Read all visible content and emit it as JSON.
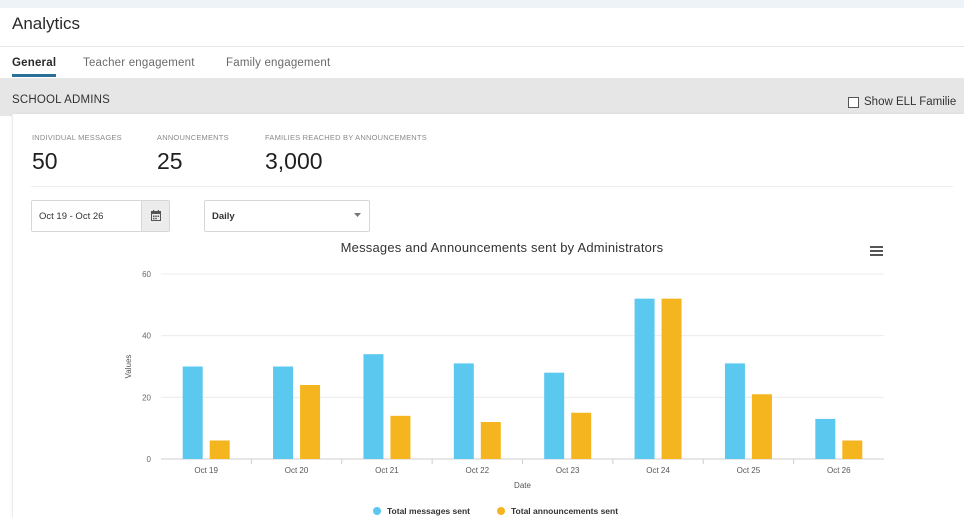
{
  "page": {
    "title": "Analytics"
  },
  "tabs": [
    {
      "label": "General",
      "active": true
    },
    {
      "label": "Teacher engagement",
      "active": false
    },
    {
      "label": "Family engagement",
      "active": false
    }
  ],
  "section": {
    "title": "SCHOOL ADMINS",
    "ell_checkbox_label": "Show ELL Familie",
    "ell_checked": false
  },
  "stats": [
    {
      "label": "INDIVIDUAL MESSAGES",
      "value": "50"
    },
    {
      "label": "ANNOUNCEMENTS",
      "value": "25"
    },
    {
      "label": "FAMILIES REACHED BY ANNOUNCEMENTS",
      "value": "3,000"
    }
  ],
  "filters": {
    "date_range": "Oct 19 - Oct 26",
    "interval": "Daily"
  },
  "icons": {
    "calendar": "calendar-icon",
    "dropdown": "chevron-down-icon",
    "menu": "hamburger-menu-icon"
  },
  "colors": {
    "accent": "#2a6f97",
    "series_messages": "#5bc8ef",
    "series_announcements": "#f5b51f"
  },
  "chart_data": {
    "type": "bar",
    "title": "Messages and Announcements sent by Administrators",
    "xlabel": "Date",
    "ylabel": "Values",
    "categories": [
      "Oct 19",
      "Oct 20",
      "Oct 21",
      "Oct 22",
      "Oct 23",
      "Oct 24",
      "Oct 25",
      "Oct 26"
    ],
    "series": [
      {
        "name": "Total messages sent",
        "values": [
          30,
          30,
          34,
          31,
          28,
          52,
          31,
          13
        ],
        "color": "#5bc8ef"
      },
      {
        "name": "Total announcements sent",
        "values": [
          6,
          24,
          14,
          12,
          15,
          52,
          21,
          6
        ],
        "color": "#f5b51f"
      }
    ],
    "yticks": [
      0,
      20,
      40,
      60
    ],
    "ylim": [
      0,
      60
    ],
    "grid": true,
    "legend": "bottom-center"
  }
}
